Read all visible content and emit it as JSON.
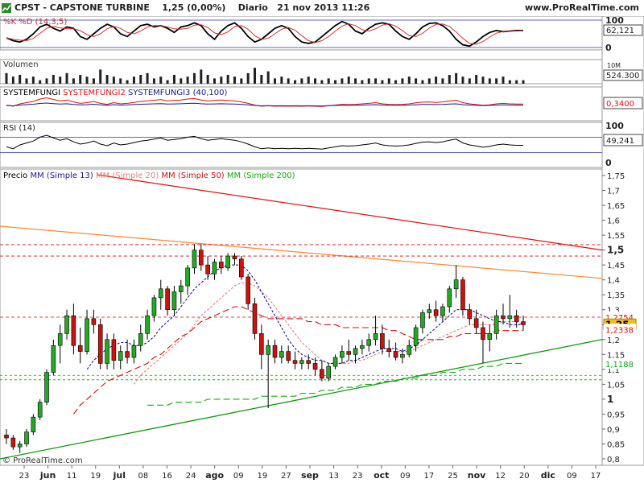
{
  "header": {
    "symbol": "CPST",
    "company": "CAPSTONE TURBINE",
    "price_change": "1,25 (0,00%)",
    "period": "Diario",
    "date": "21 nov 2013 11:26",
    "site": "www.ProRealTime.com"
  },
  "watermark": "© ProRealTime.com",
  "colors": {
    "mm13": "#1a1a8a",
    "mm20": "#e08080",
    "mm50": "#cc1111",
    "mm200": "#11aa11",
    "resistance_red": "#dd1111",
    "resistance_orange": "#ff8833",
    "support_green": "#119911",
    "price_badge": "#f0c020",
    "rsi_line": "#000000"
  },
  "panels": {
    "stoch": {
      "label": "%K %D (14,3,5)",
      "levels": [
        "100",
        "0"
      ],
      "value": "62,121"
    },
    "volume": {
      "label": "Volumen",
      "level": "10M",
      "value": "524.300"
    },
    "systemfungi": {
      "label1": "SYSTEMFUNGI",
      "label2": "SYSTEMFUNGI2",
      "label3": "SYSTEMFUNGI3 (40,100)",
      "value": "0,3400"
    },
    "rsi": {
      "label": "RSI (14)",
      "levels": [
        "100",
        "0"
      ],
      "value": "49,241"
    },
    "price": {
      "label_prefix": "Precio",
      "legend": [
        {
          "text": "MM (Simple 13)",
          "color": "#1a1a8a"
        },
        {
          "text": "MM (Simple 20)",
          "color": "#e08080"
        },
        {
          "text": "MM (Simple 50)",
          "color": "#cc1111"
        },
        {
          "text": "MM (Simple 200)",
          "color": "#11aa11"
        }
      ],
      "badges": [
        {
          "text": "1,2754",
          "color": "#cc1111"
        },
        {
          "text": "1,25",
          "color": "#000000"
        },
        {
          "text": "1,2338",
          "color": "#cc1111"
        },
        {
          "text": "1,1188",
          "color": "#11aa11"
        }
      ]
    }
  },
  "chart_data": {
    "type": "candlestick",
    "y_ticks": [
      "1,75",
      "1,7",
      "1,65",
      "1,6",
      "1,55",
      "1,5",
      "1,45",
      "1,4",
      "1,35",
      "1,3",
      "1,25",
      "1,2",
      "1,15",
      "1,1",
      "1,05",
      "1",
      "0,95",
      "0,9",
      "0,85",
      "0,8"
    ],
    "ylim": [
      0.8,
      1.75
    ],
    "x_ticks": [
      "23",
      "jun",
      "11",
      "19",
      "jul",
      "08",
      "16",
      "24",
      "ago",
      "09",
      "19",
      "27",
      "sep",
      "13",
      "23",
      "oct",
      "09",
      "17",
      "25",
      "nov",
      "12",
      "20",
      "dic",
      "09",
      "17"
    ],
    "hlines": [
      1.5,
      1.48,
      1.275,
      1.065,
      1.08
    ],
    "last_price": 1.25,
    "ohlc": [
      [
        0.88,
        0.9,
        0.85,
        0.87
      ],
      [
        0.87,
        0.88,
        0.83,
        0.84
      ],
      [
        0.84,
        0.86,
        0.82,
        0.85
      ],
      [
        0.85,
        0.9,
        0.84,
        0.89
      ],
      [
        0.89,
        0.95,
        0.88,
        0.94
      ],
      [
        0.94,
        1.0,
        0.93,
        0.99
      ],
      [
        0.99,
        1.1,
        0.98,
        1.09
      ],
      [
        1.09,
        1.2,
        1.08,
        1.18
      ],
      [
        1.18,
        1.25,
        1.12,
        1.22
      ],
      [
        1.22,
        1.3,
        1.2,
        1.28
      ],
      [
        1.28,
        1.32,
        1.15,
        1.18
      ],
      [
        1.18,
        1.24,
        1.12,
        1.16
      ],
      [
        1.16,
        1.3,
        1.15,
        1.27
      ],
      [
        1.27,
        1.3,
        1.22,
        1.25
      ],
      [
        1.25,
        1.27,
        1.1,
        1.12
      ],
      [
        1.12,
        1.22,
        1.1,
        1.2
      ],
      [
        1.2,
        1.22,
        1.1,
        1.13
      ],
      [
        1.13,
        1.18,
        1.1,
        1.16
      ],
      [
        1.16,
        1.2,
        1.12,
        1.14
      ],
      [
        1.14,
        1.2,
        1.12,
        1.18
      ],
      [
        1.18,
        1.25,
        1.16,
        1.22
      ],
      [
        1.22,
        1.3,
        1.2,
        1.28
      ],
      [
        1.28,
        1.35,
        1.26,
        1.34
      ],
      [
        1.34,
        1.4,
        1.3,
        1.37
      ],
      [
        1.37,
        1.38,
        1.28,
        1.3
      ],
      [
        1.3,
        1.38,
        1.28,
        1.36
      ],
      [
        1.36,
        1.4,
        1.32,
        1.38
      ],
      [
        1.38,
        1.45,
        1.35,
        1.44
      ],
      [
        1.44,
        1.52,
        1.42,
        1.5
      ],
      [
        1.5,
        1.52,
        1.43,
        1.45
      ],
      [
        1.45,
        1.48,
        1.4,
        1.42
      ],
      [
        1.42,
        1.47,
        1.4,
        1.46
      ],
      [
        1.46,
        1.48,
        1.42,
        1.44
      ],
      [
        1.44,
        1.49,
        1.43,
        1.48
      ],
      [
        1.48,
        1.49,
        1.45,
        1.47
      ],
      [
        1.47,
        1.48,
        1.4,
        1.41
      ],
      [
        1.41,
        1.42,
        1.3,
        1.32
      ],
      [
        1.32,
        1.34,
        1.2,
        1.22
      ],
      [
        1.22,
        1.25,
        1.1,
        1.15
      ],
      [
        1.15,
        1.2,
        0.97,
        1.18
      ],
      [
        1.18,
        1.2,
        1.12,
        1.14
      ],
      [
        1.14,
        1.18,
        1.12,
        1.16
      ],
      [
        1.16,
        1.18,
        1.12,
        1.13
      ],
      [
        1.13,
        1.16,
        1.1,
        1.12
      ],
      [
        1.12,
        1.14,
        1.1,
        1.13
      ],
      [
        1.13,
        1.15,
        1.1,
        1.12
      ],
      [
        1.12,
        1.14,
        1.08,
        1.1
      ],
      [
        1.1,
        1.13,
        1.06,
        1.07
      ],
      [
        1.07,
        1.12,
        1.06,
        1.11
      ],
      [
        1.11,
        1.15,
        1.1,
        1.14
      ],
      [
        1.14,
        1.18,
        1.12,
        1.16
      ],
      [
        1.16,
        1.2,
        1.13,
        1.15
      ],
      [
        1.15,
        1.18,
        1.12,
        1.17
      ],
      [
        1.17,
        1.2,
        1.15,
        1.18
      ],
      [
        1.18,
        1.22,
        1.16,
        1.2
      ],
      [
        1.2,
        1.28,
        1.18,
        1.22
      ],
      [
        1.22,
        1.25,
        1.15,
        1.17
      ],
      [
        1.17,
        1.2,
        1.14,
        1.16
      ],
      [
        1.16,
        1.19,
        1.13,
        1.14
      ],
      [
        1.14,
        1.17,
        1.12,
        1.15
      ],
      [
        1.15,
        1.2,
        1.14,
        1.18
      ],
      [
        1.18,
        1.25,
        1.16,
        1.24
      ],
      [
        1.24,
        1.3,
        1.22,
        1.29
      ],
      [
        1.29,
        1.32,
        1.27,
        1.3
      ],
      [
        1.3,
        1.33,
        1.26,
        1.28
      ],
      [
        1.28,
        1.32,
        1.26,
        1.31
      ],
      [
        1.31,
        1.38,
        1.29,
        1.37
      ],
      [
        1.37,
        1.45,
        1.34,
        1.4
      ],
      [
        1.4,
        1.41,
        1.28,
        1.3
      ],
      [
        1.3,
        1.32,
        1.25,
        1.27
      ],
      [
        1.27,
        1.3,
        1.22,
        1.24
      ],
      [
        1.24,
        1.26,
        1.12,
        1.2
      ],
      [
        1.2,
        1.25,
        1.16,
        1.22
      ],
      [
        1.22,
        1.3,
        1.2,
        1.28
      ],
      [
        1.28,
        1.32,
        1.25,
        1.27
      ],
      [
        1.27,
        1.35,
        1.24,
        1.28
      ],
      [
        1.28,
        1.3,
        1.24,
        1.26
      ],
      [
        1.26,
        1.28,
        1.23,
        1.25
      ]
    ],
    "volume": [
      6,
      4,
      5,
      3,
      4,
      2,
      3,
      5,
      4,
      6,
      3,
      5,
      4,
      3,
      8,
      5,
      4,
      3,
      2,
      4,
      5,
      6,
      3,
      4,
      2,
      5,
      3,
      4,
      6,
      8,
      5,
      3,
      4,
      5,
      4,
      3,
      6,
      9,
      5,
      7,
      3,
      4,
      3,
      2,
      3,
      4,
      3,
      2,
      3,
      2,
      3,
      4,
      3,
      2,
      3,
      3,
      2,
      3,
      2,
      3,
      4,
      3,
      2,
      3,
      4,
      3,
      5,
      6,
      4,
      3,
      5,
      4,
      3,
      3,
      4,
      2,
      2,
      2
    ],
    "stoch": [
      35,
      25,
      20,
      30,
      50,
      75,
      85,
      70,
      60,
      75,
      70,
      40,
      30,
      50,
      70,
      85,
      75,
      50,
      40,
      60,
      80,
      85,
      75,
      80,
      70,
      55,
      75,
      80,
      90,
      80,
      50,
      30,
      60,
      80,
      90,
      70,
      40,
      20,
      30,
      50,
      70,
      80,
      70,
      40,
      20,
      15,
      20,
      40,
      60,
      80,
      95,
      85,
      60,
      50,
      70,
      85,
      90,
      85,
      60,
      40,
      30,
      50,
      75,
      88,
      90,
      80,
      60,
      30,
      10,
      5,
      20,
      40,
      55,
      62,
      58,
      60,
      62,
      62
    ],
    "rsi": [
      45,
      40,
      50,
      55,
      60,
      70,
      75,
      68,
      62,
      66,
      58,
      52,
      55,
      60,
      52,
      48,
      55,
      50,
      52,
      56,
      60,
      62,
      65,
      68,
      62,
      64,
      66,
      70,
      72,
      66,
      62,
      64,
      66,
      64,
      62,
      58,
      52,
      45,
      40,
      42,
      40,
      41,
      40,
      41,
      40,
      41,
      40,
      39,
      42,
      45,
      48,
      47,
      48,
      50,
      52,
      55,
      50,
      48,
      47,
      48,
      50,
      54,
      57,
      58,
      56,
      58,
      62,
      65,
      55,
      50,
      47,
      44,
      46,
      50,
      52,
      50,
      49,
      49
    ],
    "mm13": [
      null,
      null,
      null,
      null,
      null,
      null,
      null,
      null,
      null,
      null,
      null,
      null,
      1.1,
      1.13,
      1.15,
      1.17,
      1.18,
      1.19,
      1.19,
      1.18,
      1.18,
      1.19,
      1.21,
      1.24,
      1.26,
      1.28,
      1.31,
      1.34,
      1.37,
      1.39,
      1.41,
      1.43,
      1.44,
      1.45,
      1.45,
      1.45,
      1.43,
      1.4,
      1.36,
      1.32,
      1.28,
      1.24,
      1.2,
      1.17,
      1.15,
      1.14,
      1.13,
      1.13,
      1.12,
      1.12,
      1.12,
      1.13,
      1.13,
      1.14,
      1.15,
      1.16,
      1.17,
      1.17,
      1.17,
      1.16,
      1.17,
      1.18,
      1.2,
      1.22,
      1.24,
      1.26,
      1.28,
      1.3,
      1.3,
      1.3,
      1.29,
      1.28,
      1.27,
      1.26,
      1.26,
      1.25,
      1.25,
      1.25
    ],
    "mm20": [
      null,
      null,
      null,
      null,
      null,
      null,
      null,
      null,
      null,
      null,
      null,
      null,
      null,
      null,
      null,
      null,
      null,
      null,
      null,
      1.05,
      1.08,
      1.1,
      1.12,
      1.14,
      1.16,
      1.18,
      1.2,
      1.22,
      1.25,
      1.28,
      1.3,
      1.32,
      1.34,
      1.36,
      1.38,
      1.39,
      1.39,
      1.38,
      1.36,
      1.34,
      1.31,
      1.28,
      1.25,
      1.22,
      1.19,
      1.17,
      1.15,
      1.13,
      1.12,
      1.12,
      1.12,
      1.12,
      1.13,
      1.13,
      1.14,
      1.15,
      1.16,
      1.16,
      1.16,
      1.16,
      1.16,
      1.17,
      1.18,
      1.19,
      1.2,
      1.21,
      1.22,
      1.23,
      1.24,
      1.25,
      1.25,
      1.25,
      1.25,
      1.25,
      1.26,
      1.26,
      1.26,
      1.25
    ],
    "mm50": [
      null,
      null,
      null,
      null,
      null,
      null,
      null,
      null,
      null,
      null,
      0.95,
      0.98,
      1.0,
      1.02,
      1.04,
      1.06,
      1.07,
      1.08,
      1.09,
      1.1,
      1.11,
      1.12,
      1.14,
      1.15,
      1.17,
      1.19,
      1.21,
      1.22,
      1.24,
      1.26,
      1.27,
      1.28,
      1.29,
      1.3,
      1.31,
      1.31,
      1.3,
      1.29,
      1.28,
      1.27,
      1.27,
      1.27,
      1.27,
      1.27,
      1.27,
      1.26,
      1.26,
      1.25,
      1.25,
      1.25,
      1.24,
      1.24,
      1.24,
      1.24,
      1.24,
      1.24,
      1.24,
      1.23,
      1.23,
      1.22,
      1.21,
      1.2,
      1.2,
      1.2,
      1.2,
      1.2,
      1.21,
      1.21,
      1.22,
      1.22,
      1.22,
      1.22,
      1.22,
      1.23,
      1.23,
      1.23,
      1.23,
      1.23
    ],
    "mm200": [
      null,
      null,
      null,
      null,
      null,
      null,
      null,
      null,
      null,
      null,
      null,
      null,
      null,
      null,
      null,
      null,
      null,
      null,
      null,
      null,
      null,
      0.98,
      0.98,
      0.98,
      0.98,
      0.99,
      0.99,
      0.99,
      0.99,
      0.99,
      1.0,
      1.0,
      1.0,
      1.0,
      1.0,
      1.0,
      1.0,
      1.0,
      1.01,
      1.01,
      1.01,
      1.01,
      1.01,
      1.01,
      1.02,
      1.02,
      1.02,
      1.03,
      1.03,
      1.03,
      1.04,
      1.04,
      1.04,
      1.05,
      1.05,
      1.05,
      1.06,
      1.06,
      1.06,
      1.07,
      1.07,
      1.07,
      1.08,
      1.08,
      1.08,
      1.09,
      1.09,
      1.09,
      1.1,
      1.1,
      1.1,
      1.11,
      1.11,
      1.11,
      1.12,
      1.12,
      1.12,
      1.12
    ]
  }
}
